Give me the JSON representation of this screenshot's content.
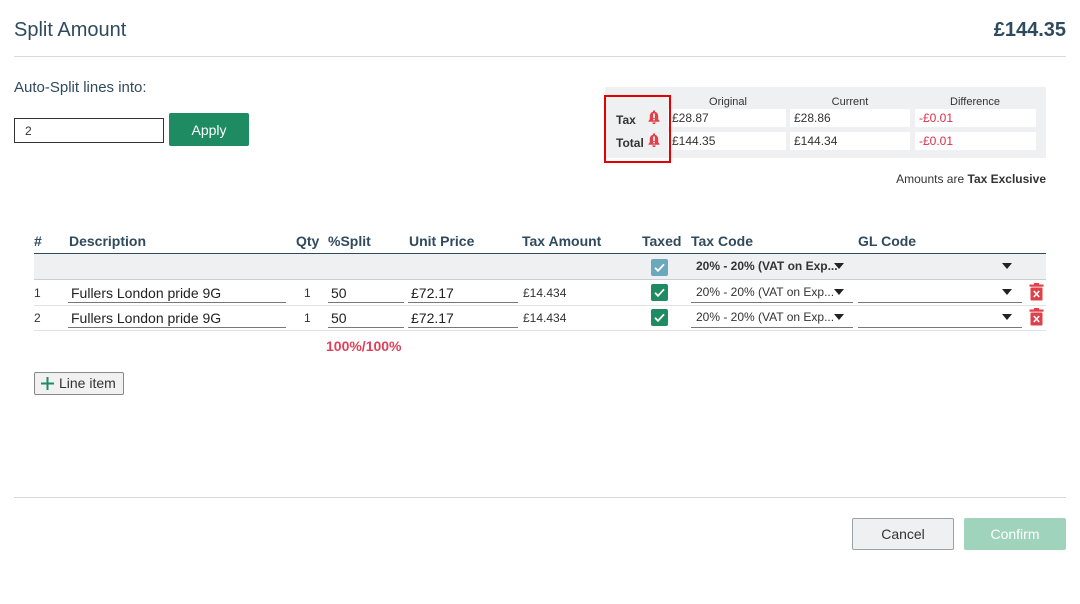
{
  "header": {
    "title": "Split Amount",
    "total": "£144.35"
  },
  "autosplit": {
    "label": "Auto-Split lines into:",
    "value": "2",
    "apply_label": "Apply"
  },
  "summary": {
    "col_original": "Original",
    "col_current": "Current",
    "col_difference": "Difference",
    "rows": [
      {
        "label": "Tax",
        "original": "£28.87",
        "current": "£28.86",
        "difference": "-£0.01"
      },
      {
        "label": "Total",
        "original": "£144.35",
        "current": "£144.34",
        "difference": "-£0.01"
      }
    ],
    "note_prefix": "Amounts are",
    "note_bold": "Tax Exclusive"
  },
  "table": {
    "headers": {
      "num": "#",
      "description": "Description",
      "qty": "Qty",
      "split": "%Split",
      "unit_price": "Unit Price",
      "tax_amount": "Tax Amount",
      "taxed": "Taxed",
      "tax_code": "Tax Code",
      "gl_code": "GL Code"
    },
    "bulk_tax_code": "20% - 20% (VAT on Exp...",
    "rows": [
      {
        "num": "1",
        "description": "Fullers London pride 9G",
        "qty": "1",
        "split": "50",
        "unit_price": "£72.17",
        "tax_amount": "£14.434",
        "tax_code": "20% - 20% (VAT on Exp..."
      },
      {
        "num": "2",
        "description": "Fullers London pride 9G",
        "qty": "1",
        "split": "50",
        "unit_price": "£72.17",
        "tax_amount": "£14.434",
        "tax_code": "20% - 20% (VAT on Exp..."
      }
    ],
    "split_total": "100%/100%"
  },
  "actions": {
    "line_item_label": "Line item",
    "cancel_label": "Cancel",
    "confirm_label": "Confirm"
  },
  "colors": {
    "accent": "#1f8b63",
    "danger": "#d9304a",
    "heading": "#2f4a5e"
  }
}
